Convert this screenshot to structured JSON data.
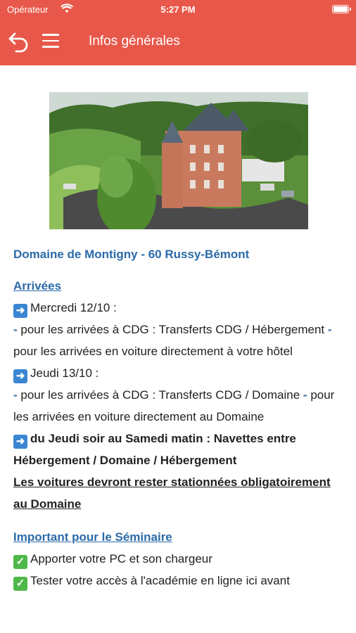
{
  "status_bar": {
    "carrier": "Opérateur",
    "time": "5:27 PM"
  },
  "nav": {
    "title": "Infos générales"
  },
  "venue": "Domaine de Montigny - 60 Russy-Bémont",
  "arrivals": {
    "heading": "Arrivées",
    "day1": "Mercredi 12/10 :",
    "day1_line1_dash": "-",
    "day1_line1": " pour les arrivées à CDG : Transferts CDG / Hébergement ",
    "day1_line2_dash": "-",
    "day1_line2": " pour les arrivées en voiture directement à votre hôtel",
    "day2": "Jeudi 13/10 :",
    "day2_line1_dash": "-",
    "day2_line1": " pour les arrivées à CDG : Transferts CDG / Domaine ",
    "day2_line2_dash": "-",
    "day2_line2": " pour les arrivées en voiture directement au Domaine",
    "shuttle": "du Jeudi soir au Samedi matin : Navettes entre Hébergement / Domaine / Hébergement",
    "parking": "Les voitures devront rester stationnées obligatoirement au Domaine"
  },
  "seminar": {
    "heading": "Important pour le Séminaire",
    "item1": "Apporter votre PC et son chargeur",
    "item2": "Tester votre accès à l'académie en ligne ici avant"
  },
  "icons": {
    "arrow": "right-arrow-emoji-icon",
    "check": "check-mark-emoji-icon"
  },
  "colors": {
    "accent": "#e8584a",
    "link": "#2b6aa8"
  }
}
